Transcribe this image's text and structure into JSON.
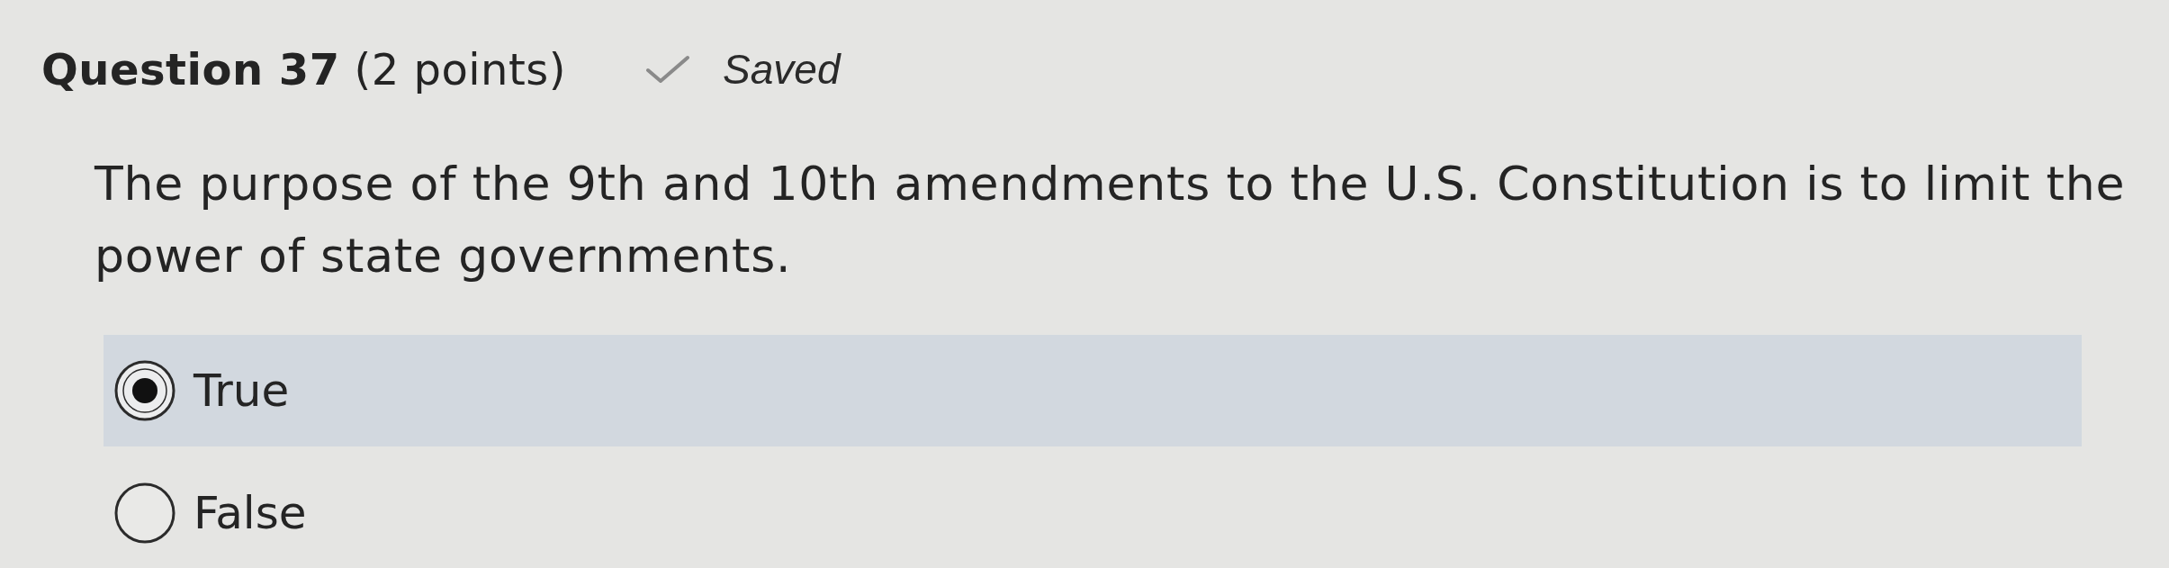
{
  "question": {
    "title": "**Question 37** (2 points)",
    "status": "Saved",
    "prompt": "The purpose of the 9th and 10th amendments to the U.S. Constitution is to limit the power of state governments.",
    "options": [
      {
        "label": "True",
        "selected": true
      },
      {
        "label": "False",
        "selected": false
      }
    ]
  }
}
